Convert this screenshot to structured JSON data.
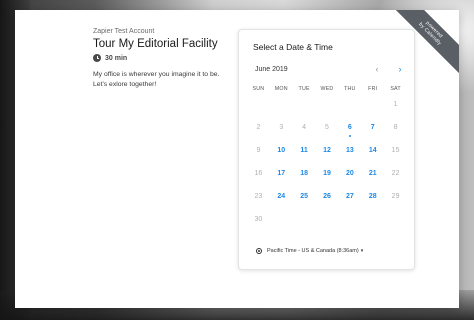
{
  "event": {
    "account": "Zapier Test Account",
    "title": "Tour My Editorial Facility",
    "duration": "30 min",
    "description": "My office is wherever you imagine it to be. Let's exlore together!"
  },
  "ribbon": {
    "line1": "powered",
    "line2": "by Calendly"
  },
  "calendar": {
    "heading": "Select a Date & Time",
    "month": "June 2019",
    "prev_icon": "‹",
    "next_icon": "›",
    "weekdays": [
      "SUN",
      "MON",
      "TUE",
      "WED",
      "THU",
      "FRI",
      "SAT"
    ],
    "days": [
      {
        "label": "",
        "available": false
      },
      {
        "label": "",
        "available": false
      },
      {
        "label": "",
        "available": false
      },
      {
        "label": "",
        "available": false
      },
      {
        "label": "",
        "available": false
      },
      {
        "label": "",
        "available": false
      },
      {
        "label": "1",
        "available": false
      },
      {
        "label": "2",
        "available": false
      },
      {
        "label": "3",
        "available": false
      },
      {
        "label": "4",
        "available": false
      },
      {
        "label": "5",
        "available": false
      },
      {
        "label": "6",
        "available": true,
        "today": true
      },
      {
        "label": "7",
        "available": true
      },
      {
        "label": "8",
        "available": false
      },
      {
        "label": "9",
        "available": false
      },
      {
        "label": "10",
        "available": true
      },
      {
        "label": "11",
        "available": true
      },
      {
        "label": "12",
        "available": true
      },
      {
        "label": "13",
        "available": true
      },
      {
        "label": "14",
        "available": true
      },
      {
        "label": "15",
        "available": false
      },
      {
        "label": "16",
        "available": false
      },
      {
        "label": "17",
        "available": true
      },
      {
        "label": "18",
        "available": true
      },
      {
        "label": "19",
        "available": true
      },
      {
        "label": "20",
        "available": true
      },
      {
        "label": "21",
        "available": true
      },
      {
        "label": "22",
        "available": false
      },
      {
        "label": "23",
        "available": false
      },
      {
        "label": "24",
        "available": true
      },
      {
        "label": "25",
        "available": true
      },
      {
        "label": "26",
        "available": true
      },
      {
        "label": "27",
        "available": true
      },
      {
        "label": "28",
        "available": true
      },
      {
        "label": "29",
        "available": false
      },
      {
        "label": "30",
        "available": false
      }
    ],
    "timezone": "Pacific Time - US & Canada (8:36am)",
    "timezone_caret": "▾"
  },
  "colors": {
    "accent": "#1e88e5",
    "muted": "#b0b0b0"
  }
}
